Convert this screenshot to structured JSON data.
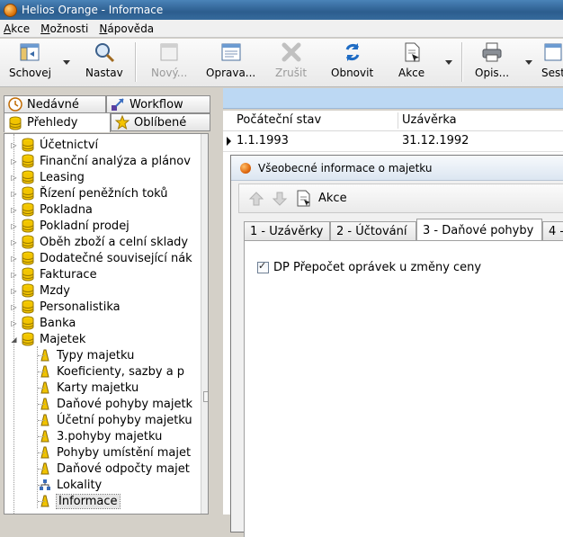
{
  "window": {
    "title": "Helios Orange - Informace"
  },
  "menu": [
    "Akce",
    "Možnosti",
    "Nápověda"
  ],
  "toolbar": {
    "schovej": "Schovej",
    "nastav": "Nastav",
    "novy": "Nový...",
    "oprava": "Oprava...",
    "zrusit": "Zrušit",
    "obnovit": "Obnovit",
    "akce": "Akce",
    "opis": "Opis...",
    "sest": "Sest"
  },
  "left_tabs": {
    "nedavne": "Nedávné",
    "workflow": "Workflow",
    "prehledy": "Přehledy",
    "oblibene": "Oblíbené"
  },
  "tree": [
    {
      "label": "Účetnictví",
      "type": "db"
    },
    {
      "label": "Finanční analýza a plánov",
      "type": "db"
    },
    {
      "label": "Leasing",
      "type": "db"
    },
    {
      "label": "Řízení peněžních toků",
      "type": "db"
    },
    {
      "label": "Pokladna",
      "type": "db"
    },
    {
      "label": "Pokladní prodej",
      "type": "db"
    },
    {
      "label": "Oběh zboží a celní sklady",
      "type": "db"
    },
    {
      "label": "Dodatečné související nák",
      "type": "db"
    },
    {
      "label": "Fakturace",
      "type": "db"
    },
    {
      "label": "Mzdy",
      "type": "db"
    },
    {
      "label": "Personalistika",
      "type": "db"
    },
    {
      "label": "Banka",
      "type": "db"
    },
    {
      "label": "Majetek",
      "type": "db"
    },
    {
      "label": "Typy majetku",
      "type": "folder"
    },
    {
      "label": "Koeficienty, sazby a p",
      "type": "folder"
    },
    {
      "label": "Karty majetku",
      "type": "folder"
    },
    {
      "label": "Daňové pohyby majetk",
      "type": "folder"
    },
    {
      "label": "Účetní pohyby majetku",
      "type": "folder"
    },
    {
      "label": "3.pohyby majetku",
      "type": "folder"
    },
    {
      "label": "Pohyby umístění majet",
      "type": "folder"
    },
    {
      "label": "Daňové odpočty majet",
      "type": "folder"
    },
    {
      "label": "Lokality",
      "type": "network"
    },
    {
      "label": "Informace",
      "type": "folder"
    }
  ],
  "grid": {
    "columns": [
      "Počáteční stav",
      "Uzávěrka"
    ],
    "rows": [
      [
        "1.1.1993",
        "31.12.1992"
      ]
    ]
  },
  "dialog": {
    "title": "Všeobecné informace o majetku",
    "akce": "Akce",
    "tabs": [
      "1 - Uzávěrky",
      "2 - Účtování",
      "3 - Daňové pohyby",
      "4 -"
    ],
    "checkbox_label": "DP Přepočet oprávek u změny ceny",
    "checkbox_checked": true
  }
}
